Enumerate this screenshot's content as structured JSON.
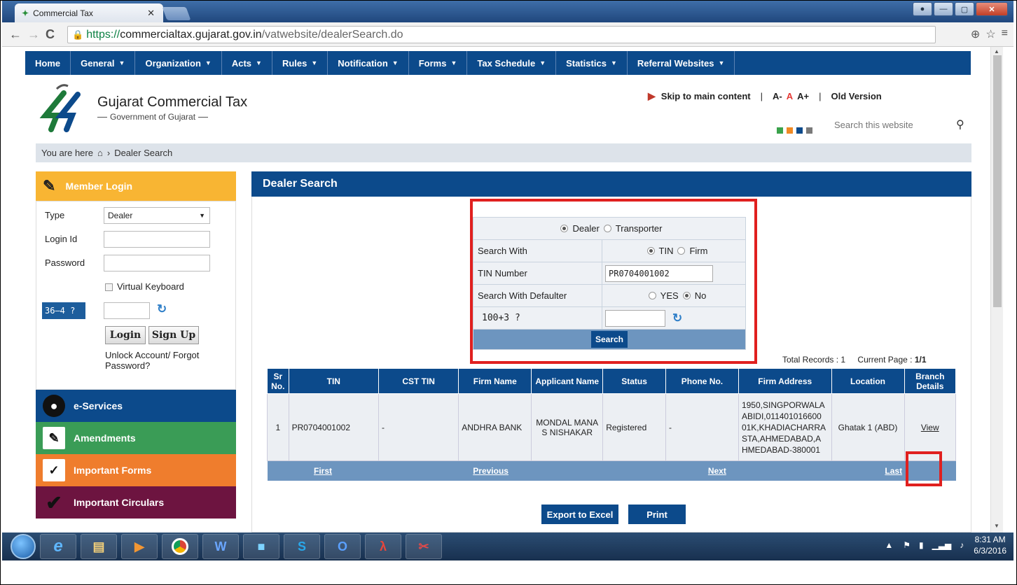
{
  "browser": {
    "tab_title": "Commercial Tax",
    "url_scheme": "https://",
    "url_host": "commercialtax.gujarat.gov.in",
    "url_path": "/vatwebsite/dealerSearch.do"
  },
  "menu": [
    {
      "label": "Home",
      "caret": false
    },
    {
      "label": "General",
      "caret": true
    },
    {
      "label": "Organization",
      "caret": true
    },
    {
      "label": "Acts",
      "caret": true
    },
    {
      "label": "Rules",
      "caret": true
    },
    {
      "label": "Notification",
      "caret": true
    },
    {
      "label": "Forms",
      "caret": true
    },
    {
      "label": "Tax Schedule",
      "caret": true
    },
    {
      "label": "Statistics",
      "caret": true
    },
    {
      "label": "Referral Websites",
      "caret": true
    }
  ],
  "brand": {
    "name": "Gujarat Commercial Tax",
    "subtitle": "Government of Gujarat"
  },
  "toplinks": {
    "skip": "Skip to main content",
    "a_minus": "A-",
    "a": "A",
    "a_plus": "A+",
    "old": "Old Version",
    "search_placeholder": "Search this website"
  },
  "colors": {
    "sq1": "#3aa24b",
    "sq2": "#f08a24",
    "sq3": "#0c4a8b",
    "sq4": "#7a7a7a"
  },
  "breadcrumb": {
    "prefix": "You are here",
    "current": "Dealer Search"
  },
  "login": {
    "title": "Member Login",
    "type_label": "Type",
    "type_value": "Dealer",
    "login_id_label": "Login Id",
    "password_label": "Password",
    "virtual_keyboard": "Virtual Keyboard",
    "captcha": "36–4 ?",
    "login_btn": "Login",
    "signup_btn": "Sign Up",
    "unlock": "Unlock Account/ Forgot Password?"
  },
  "sidenav": [
    {
      "label": "e-Services",
      "color": "#0c4a8b"
    },
    {
      "label": "Amendments",
      "color": "#3a9c56"
    },
    {
      "label": "Important Forms",
      "color": "#ef7d2d"
    },
    {
      "label": "Important Circulars",
      "color": "#6d1440"
    }
  ],
  "main": {
    "title": "Dealer Search",
    "form": {
      "opt_dealer": "Dealer",
      "opt_transporter": "Transporter",
      "search_with_label": "Search With",
      "opt_tin": "TIN",
      "opt_firm": "Firm",
      "tin_label": "TIN Number",
      "tin_value": "PR0704001002",
      "defaulter_label": "Search With Defaulter",
      "opt_yes": "YES",
      "opt_no": "No",
      "captcha": "100+3 ?",
      "search_btn": "Search"
    },
    "total_records_label": "Total Records :",
    "total_records": "1",
    "current_page_label": "Current Page :",
    "current_page": "1/1",
    "table": {
      "headers": [
        "Sr No.",
        "TIN",
        "CST TIN",
        "Firm Name",
        "Applicant Name",
        "Status",
        "Phone No.",
        "Firm Address",
        "Location",
        "Branch Details"
      ],
      "row": {
        "sr": "1",
        "tin": "PR0704001002",
        "cst": "-",
        "firm": "ANDHRA BANK",
        "applicant": "MONDAL MANA S NISHAKAR",
        "status": "Registered",
        "phone": "-",
        "address": "1950,SINGPORWALA ABIDI,011401016600 01K,KHADIACHARRA STA,AHMEDABAD,A HMEDABAD-380001",
        "location": "Ghatak 1 (ABD)",
        "branch": "View"
      },
      "pager": [
        "First",
        "Previous",
        "Next",
        "Last"
      ]
    },
    "export_btn": "Export to Excel",
    "print_btn": "Print"
  },
  "taskbar": {
    "time": "8:31 AM",
    "date": "6/3/2016"
  }
}
